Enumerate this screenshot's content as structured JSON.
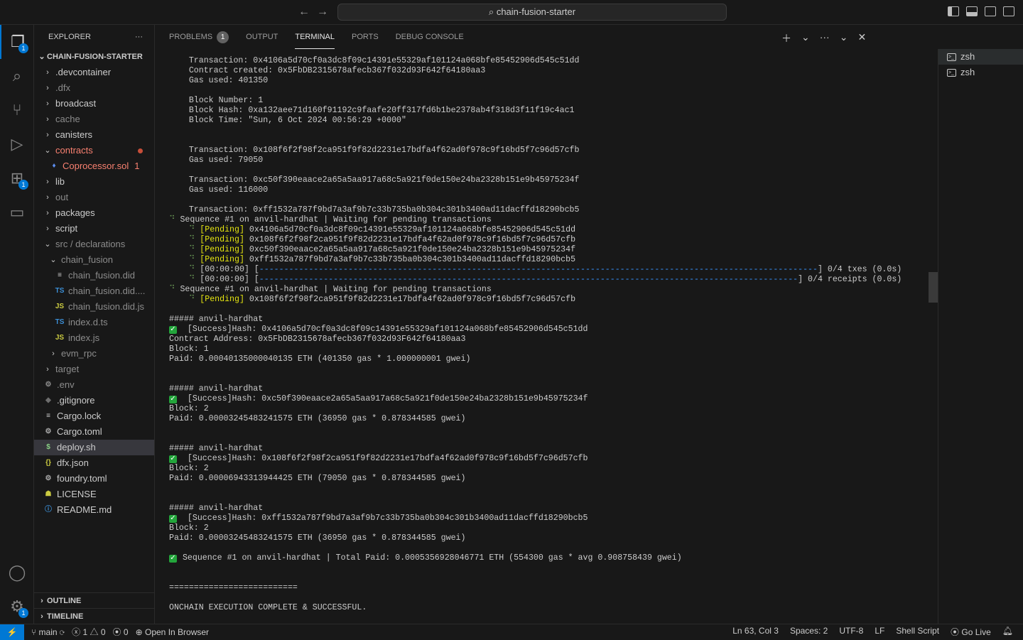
{
  "title": {
    "search": "chain-fusion-starter"
  },
  "activity": {
    "explorer_badge": "1",
    "extensions_badge": "1",
    "settings_badge": "1"
  },
  "explorer": {
    "header": "EXPLORER",
    "root": "CHAIN-FUSION-STARTER",
    "items": [
      {
        "label": ".devcontainer",
        "type": "folder",
        "depth": 1,
        "open": false
      },
      {
        "label": ".dfx",
        "type": "folder",
        "depth": 1,
        "open": false,
        "dim": true
      },
      {
        "label": "broadcast",
        "type": "folder",
        "depth": 1,
        "open": false
      },
      {
        "label": "cache",
        "type": "folder",
        "depth": 1,
        "open": false,
        "dim": true
      },
      {
        "label": "canisters",
        "type": "folder",
        "depth": 1,
        "open": false
      },
      {
        "label": "contracts",
        "type": "folder",
        "depth": 1,
        "open": true,
        "error": true,
        "dot": true
      },
      {
        "label": "Coprocessor.sol",
        "type": "file",
        "icon": "ethereum-icon",
        "glyph": "♦",
        "color": "#5b8def",
        "depth": 2,
        "error": true,
        "count": "1"
      },
      {
        "label": "lib",
        "type": "folder",
        "depth": 1,
        "open": false
      },
      {
        "label": "out",
        "type": "folder",
        "depth": 1,
        "open": false,
        "dim": true
      },
      {
        "label": "packages",
        "type": "folder",
        "depth": 1,
        "open": false
      },
      {
        "label": "script",
        "type": "folder",
        "depth": 1,
        "open": false
      },
      {
        "label": "src / declarations",
        "type": "folder",
        "depth": 1,
        "open": true,
        "dim": true
      },
      {
        "label": "chain_fusion",
        "type": "folder",
        "depth": 2,
        "open": true,
        "dim": true
      },
      {
        "label": "chain_fusion.did",
        "type": "file",
        "icon": "lines-icon",
        "glyph": "≡",
        "color": "#ccc",
        "depth": 3,
        "dim": true
      },
      {
        "label": "chain_fusion.did....",
        "type": "file",
        "icon": "typescript-icon",
        "glyph": "TS",
        "color": "#3c8fd6",
        "depth": 3,
        "dim": true
      },
      {
        "label": "chain_fusion.did.js",
        "type": "file",
        "icon": "javascript-icon",
        "glyph": "JS",
        "color": "#cbcb41",
        "depth": 3,
        "dim": true
      },
      {
        "label": "index.d.ts",
        "type": "file",
        "icon": "typescript-icon",
        "glyph": "TS",
        "color": "#3c8fd6",
        "depth": 3,
        "dim": true
      },
      {
        "label": "index.js",
        "type": "file",
        "icon": "javascript-icon",
        "glyph": "JS",
        "color": "#cbcb41",
        "depth": 3,
        "dim": true
      },
      {
        "label": "evm_rpc",
        "type": "folder",
        "depth": 2,
        "open": false,
        "dim": true
      },
      {
        "label": "target",
        "type": "folder",
        "depth": 1,
        "open": false,
        "dim": true
      },
      {
        "label": ".env",
        "type": "file",
        "icon": "gear-icon",
        "glyph": "⚙",
        "color": "#8c8c8c",
        "depth": 1,
        "dim": true
      },
      {
        "label": ".gitignore",
        "type": "file",
        "icon": "git-icon",
        "glyph": "◆",
        "color": "#6d6d6d",
        "depth": 1
      },
      {
        "label": "Cargo.lock",
        "type": "file",
        "icon": "lines-icon",
        "glyph": "≡",
        "color": "#ccc",
        "depth": 1
      },
      {
        "label": "Cargo.toml",
        "type": "file",
        "icon": "gear-icon",
        "glyph": "⚙",
        "color": "#aaa",
        "depth": 1
      },
      {
        "label": "deploy.sh",
        "type": "file",
        "icon": "dollar-icon",
        "glyph": "$",
        "color": "#89d185",
        "depth": 1,
        "selected": true
      },
      {
        "label": "dfx.json",
        "type": "file",
        "icon": "braces-icon",
        "glyph": "{}",
        "color": "#cbcb41",
        "depth": 1
      },
      {
        "label": "foundry.toml",
        "type": "file",
        "icon": "gear-icon",
        "glyph": "⚙",
        "color": "#aaa",
        "depth": 1
      },
      {
        "label": "LICENSE",
        "type": "file",
        "icon": "license-icon",
        "glyph": "☗",
        "color": "#cbcb41",
        "depth": 1
      },
      {
        "label": "README.md",
        "type": "file",
        "icon": "info-icon",
        "glyph": "ⓘ",
        "color": "#3c8fd6",
        "depth": 1
      }
    ],
    "outline": "OUTLINE",
    "timeline": "TIMELINE"
  },
  "panel": {
    "tabs": [
      {
        "label": "PROBLEMS",
        "badge": "1"
      },
      {
        "label": "OUTPUT"
      },
      {
        "label": "TERMINAL",
        "active": true
      },
      {
        "label": "PORTS"
      },
      {
        "label": "DEBUG CONSOLE"
      }
    ],
    "terminals": [
      "zsh",
      "zsh"
    ],
    "progress": {
      "txes": 0,
      "receipts": 0
    },
    "lines": [
      [
        [
          "    Transaction: 0x4106a5d70cf0a3dc8f09c14391e55329af101124a068bfe85452906d545c51dd",
          ""
        ]
      ],
      [
        [
          "    Contract created: 0x5FbDB2315678afecb367f032d93F642f64180aa3",
          ""
        ]
      ],
      [
        [
          "    Gas used: 401350",
          ""
        ]
      ],
      [],
      [
        [
          "    Block Number: 1",
          ""
        ]
      ],
      [
        [
          "    Block Hash: 0xa132aee71d160f91192c9faafe20ff317fd6b1be2378ab4f318d3f11f19c4ac1",
          ""
        ]
      ],
      [
        [
          "    Block Time: \"Sun, 6 Oct 2024 00:56:29 +0000\"",
          ""
        ]
      ],
      [],
      [],
      [
        [
          "    Transaction: 0x108f6f2f98f2ca951f9f82d2231e17bdfa4f62ad0f978c9f16bd5f7c96d57cfb",
          ""
        ]
      ],
      [
        [
          "    Gas used: 79050",
          ""
        ]
      ],
      [],
      [
        [
          "    Transaction: 0xc50f390eaace2a65a5aa917a68c5a921f0de150e24ba2328b151e9b45975234f",
          ""
        ]
      ],
      [
        [
          "    Gas used: 116000",
          ""
        ]
      ],
      [],
      [
        [
          "    Transaction: 0xff1532a787f9bd7a3af9b7c33b735ba0b304c301b3400ad11dacffd18290bcb5",
          ""
        ]
      ],
      [
        [
          "⠙",
          "spin"
        ],
        [
          " Sequence #1 on anvil-hardhat | Waiting for pending transactions",
          ""
        ]
      ],
      [
        [
          "    ⠙",
          "spin"
        ],
        [
          " [Pending]",
          "c-y"
        ],
        [
          " 0x4106a5d70cf0a3dc8f09c14391e55329af101124a068bfe85452906d545c51dd",
          ""
        ]
      ],
      [
        [
          "    ⠙",
          "spin"
        ],
        [
          " [Pending]",
          "c-y"
        ],
        [
          " 0x108f6f2f98f2ca951f9f82d2231e17bdfa4f62ad0f978c9f16bd5f7c96d57cfb",
          ""
        ]
      ],
      [
        [
          "    ⠙",
          "spin"
        ],
        [
          " [Pending]",
          "c-y"
        ],
        [
          " 0xc50f390eaace2a65a5aa917a68c5a921f0de150e24ba2328b151e9b45975234f",
          ""
        ]
      ],
      [
        [
          "    ⠙",
          "spin"
        ],
        [
          " [Pending]",
          "c-y"
        ],
        [
          " 0xff1532a787f9bd7a3af9b7c33b735ba0b304c301b3400ad11dacffd18290bcb5",
          ""
        ]
      ],
      [
        [
          "    ⠙",
          "spin"
        ],
        [
          " [00:00:00] [",
          ""
        ],
        [
          "-----------------------------------------------------------------------------------------------------------------",
          "c-bar"
        ],
        [
          "] 0/4 txes (0.0s)",
          ""
        ]
      ],
      [
        [
          "    ⠙",
          "spin"
        ],
        [
          " [00:00:00] [",
          ""
        ],
        [
          "-------------------------------------------------------------------------------------------------------------",
          "c-bar"
        ],
        [
          "] 0/4 receipts (0.0s)",
          ""
        ]
      ],
      [
        [
          "⠙",
          "spin"
        ],
        [
          " Sequence #1 on anvil-hardhat | Waiting for pending transactions",
          ""
        ]
      ],
      [
        [
          "    ⠙",
          "spin"
        ],
        [
          " [Pending]",
          "c-y"
        ],
        [
          " 0x108f6f2f98f2ca951f9f82d2231e17bdfa4f62ad0f978c9f16bd5f7c96d57cfb",
          ""
        ]
      ],
      [],
      [
        [
          "##### anvil-hardhat",
          ""
        ]
      ],
      [
        [
          "✓",
          "c-chk"
        ],
        [
          "  [Success]Hash: 0x4106a5d70cf0a3dc8f09c14391e55329af101124a068bfe85452906d545c51dd",
          ""
        ]
      ],
      [
        [
          "Contract Address: 0x5FbDB2315678afecb367f032d93F642f64180aa3",
          ""
        ]
      ],
      [
        [
          "Block: 1",
          ""
        ]
      ],
      [
        [
          "Paid: 0.00040135000040135 ETH (401350 gas * 1.000000001 gwei)",
          ""
        ]
      ],
      [],
      [],
      [
        [
          "##### anvil-hardhat",
          ""
        ]
      ],
      [
        [
          "✓",
          "c-chk"
        ],
        [
          "  [Success]Hash: 0xc50f390eaace2a65a5aa917a68c5a921f0de150e24ba2328b151e9b45975234f",
          ""
        ]
      ],
      [
        [
          "Block: 2",
          ""
        ]
      ],
      [
        [
          "Paid: 0.00003245483241575 ETH (36950 gas * 0.878344585 gwei)",
          ""
        ]
      ],
      [],
      [],
      [
        [
          "##### anvil-hardhat",
          ""
        ]
      ],
      [
        [
          "✓",
          "c-chk"
        ],
        [
          "  [Success]Hash: 0x108f6f2f98f2ca951f9f82d2231e17bdfa4f62ad0f978c9f16bd5f7c96d57cfb",
          ""
        ]
      ],
      [
        [
          "Block: 2",
          ""
        ]
      ],
      [
        [
          "Paid: 0.00006943313944425 ETH (79050 gas * 0.878344585 gwei)",
          ""
        ]
      ],
      [],
      [],
      [
        [
          "##### anvil-hardhat",
          ""
        ]
      ],
      [
        [
          "✓",
          "c-chk"
        ],
        [
          "  [Success]Hash: 0xff1532a787f9bd7a3af9b7c33b735ba0b304c301b3400ad11dacffd18290bcb5",
          ""
        ]
      ],
      [
        [
          "Block: 2",
          ""
        ]
      ],
      [
        [
          "Paid: 0.00003245483241575 ETH (36950 gas * 0.878344585 gwei)",
          ""
        ]
      ],
      [],
      [
        [
          "✓",
          "c-chk"
        ],
        [
          " Sequence #1 on anvil-hardhat | Total Paid: 0.0005356928046771 ETH (554300 gas * avg 0.908758439 gwei)",
          ""
        ]
      ],
      [],
      [],
      [
        [
          "==========================",
          ""
        ]
      ],
      [],
      [
        [
          "ONCHAIN EXECUTION COMPLETE & SUCCESSFUL.",
          ""
        ]
      ]
    ]
  },
  "status": {
    "branch": "main",
    "errors": "1",
    "warnings": "0",
    "ports": "0",
    "open_browser": "Open In Browser",
    "position": "Ln 63, Col 3",
    "spaces": "Spaces: 2",
    "encoding": "UTF-8",
    "eol": "LF",
    "language": "Shell Script",
    "golive": "Go Live"
  },
  "colors": {
    "accent": "#0078d4",
    "error": "#f88070",
    "pending": "#e5e510",
    "success": "#23a53b"
  }
}
